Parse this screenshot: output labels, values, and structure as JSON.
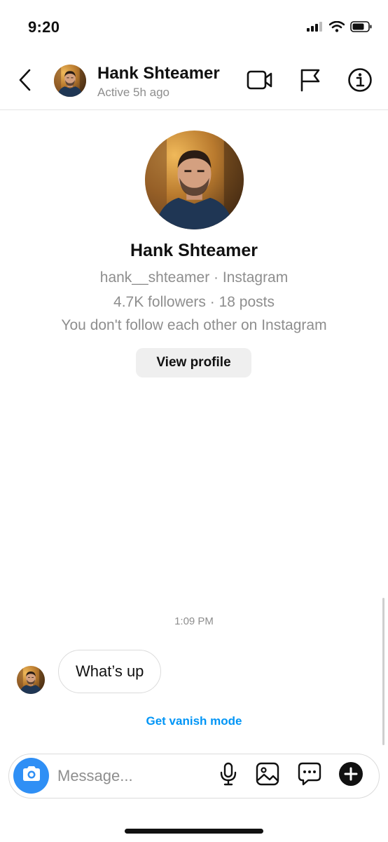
{
  "status_bar": {
    "time": "9:20",
    "icons": [
      "cellular-signal-icon",
      "wifi-icon",
      "battery-icon"
    ]
  },
  "header": {
    "back_icon": "chevron-left-icon",
    "name": "Hank Shteamer",
    "active_status": "Active 5h ago",
    "actions": [
      "video-call-icon",
      "flag-icon",
      "info-icon"
    ]
  },
  "profile": {
    "name": "Hank Shteamer",
    "handle_line": "hank__shteamer · Instagram",
    "stats_line": "4.7K followers · 18 posts",
    "relation_line": "You don't follow each other on Instagram",
    "view_profile_label": "View profile"
  },
  "chat": {
    "timestamp": "1:09 PM",
    "messages": [
      {
        "text": "What’s up",
        "from": "other"
      }
    ],
    "vanish_mode_link": "Get vanish mode"
  },
  "composer": {
    "placeholder": "Message...",
    "icons": [
      "camera-icon",
      "microphone-icon",
      "image-icon",
      "sticker-chat-icon",
      "plus-icon"
    ]
  },
  "colors": {
    "accent_blue": "#0095f6",
    "camera_button": "#2f8ff5",
    "secondary_text": "#8e8e8e",
    "button_bg": "#efefef",
    "border": "#dbdbdb"
  }
}
